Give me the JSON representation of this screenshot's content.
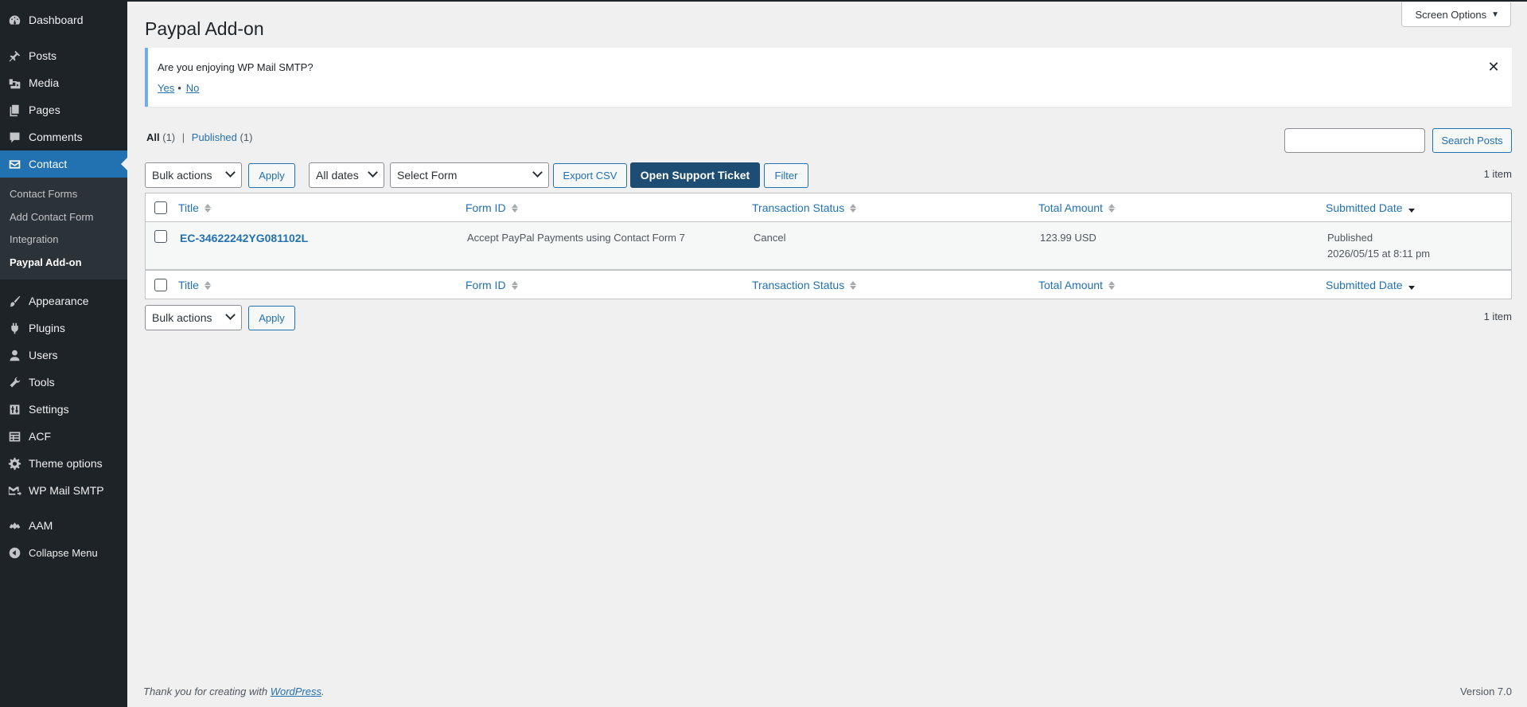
{
  "menu": {
    "dashboard": "Dashboard",
    "posts": "Posts",
    "media": "Media",
    "pages": "Pages",
    "comments": "Comments",
    "contact": "Contact",
    "contact_sub": [
      "Contact Forms",
      "Add Contact Form",
      "Integration",
      "Paypal Add-on"
    ],
    "appearance": "Appearance",
    "plugins": "Plugins",
    "users": "Users",
    "tools": "Tools",
    "settings": "Settings",
    "acf": "ACF",
    "theme_options": "Theme options",
    "wp_mail_smtp": "WP Mail SMTP",
    "aam": "AAM",
    "collapse": "Collapse Menu"
  },
  "screen_options": "Screen Options",
  "page_title": "Paypal Add-on",
  "notice": {
    "text": "Are you enjoying WP Mail SMTP?",
    "yes": "Yes",
    "no": "No",
    "separator": "•",
    "close": "✕"
  },
  "views": {
    "all_label": "All",
    "all_count": "(1)",
    "separator": "|",
    "published_label": "Published",
    "published_count": "(1)"
  },
  "search": {
    "placeholder": "",
    "button": "Search Posts"
  },
  "toolbar": {
    "bulk_actions": "Bulk actions",
    "apply": "Apply",
    "all_dates": "All dates",
    "select_form": "Select Form",
    "export_csv": "Export CSV",
    "open_support": "Open Support Ticket",
    "filter": "Filter",
    "item_count": "1 item"
  },
  "table": {
    "columns": [
      "Title",
      "Form ID",
      "Transaction Status",
      "Total Amount",
      "Submitted Date"
    ],
    "rows": [
      {
        "title": "EC-34622242YG081102L",
        "form_id": "Accept PayPal Payments using Contact Form 7",
        "status": "Cancel",
        "amount": "123.99 USD",
        "date_status": "Published",
        "date": "2026/05/15 at 8:11 pm"
      }
    ]
  },
  "footer": {
    "text": "Thank you for creating with ",
    "link": "WordPress",
    "period": ".",
    "version": "Version 7.0"
  },
  "colors": {
    "sidebar": "#1d2327",
    "accent": "#2271b1",
    "primary_button": "#1d4d73"
  }
}
